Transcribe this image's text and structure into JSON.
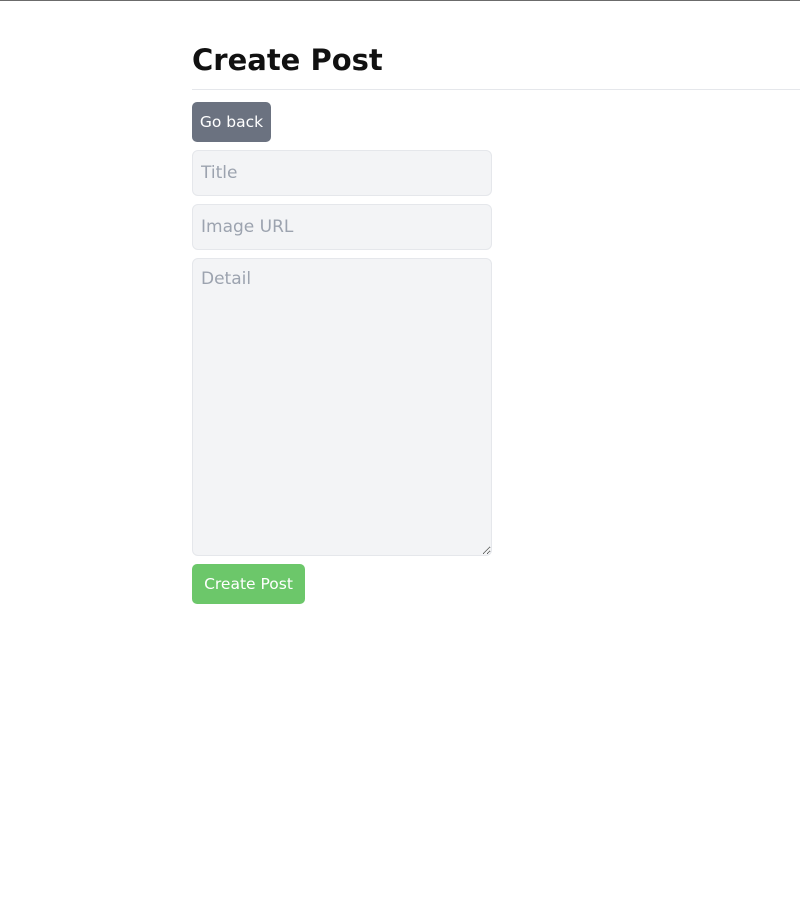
{
  "page": {
    "title": "Create Post"
  },
  "actions": {
    "back_label": "Go back",
    "submit_label": "Create Post"
  },
  "form": {
    "title": {
      "value": "",
      "placeholder": "Title"
    },
    "image_url": {
      "value": "",
      "placeholder": "Image URL"
    },
    "detail": {
      "value": "",
      "placeholder": "Detail"
    }
  },
  "colors": {
    "back_button": "#6b7280",
    "submit_button": "#6cc76a",
    "field_background": "#f3f4f6",
    "placeholder_text": "#9ca3af"
  }
}
